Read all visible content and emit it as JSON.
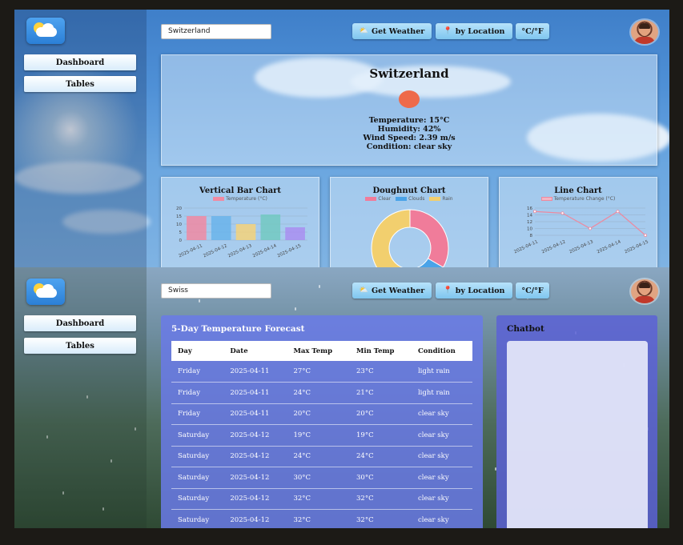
{
  "top": {
    "sidebar": {
      "items": [
        {
          "label": "Dashboard"
        },
        {
          "label": "Tables"
        }
      ]
    },
    "search": {
      "value": "Switzerland"
    },
    "toolbar": {
      "get_weather": "Get Weather",
      "by_location": "by Location",
      "unit_toggle": "°C/°F"
    },
    "current": {
      "city": "Switzerland",
      "temperature": "Temperature: 15°C",
      "humidity": "Humidity: 42%",
      "wind": "Wind Speed: 2.39 m/s",
      "condition": "Condition: clear sky"
    },
    "charts": {
      "bar_title": "Vertical Bar Chart",
      "doughnut_title": "Doughnut Chart",
      "line_title": "Line Chart"
    }
  },
  "bottom": {
    "sidebar": {
      "items": [
        {
          "label": "Dashboard"
        },
        {
          "label": "Tables"
        }
      ]
    },
    "search": {
      "value": "Swiss"
    },
    "toolbar": {
      "get_weather": "Get Weather",
      "by_location": "by Location",
      "unit_toggle": "°C/°F"
    },
    "forecast": {
      "title": "5-Day Temperature Forecast",
      "columns": [
        "Day",
        "Date",
        "Max Temp",
        "Min Temp",
        "Condition"
      ],
      "rows": [
        [
          "Friday",
          "2025-04-11",
          "27°C",
          "23°C",
          "light rain"
        ],
        [
          "Friday",
          "2025-04-11",
          "24°C",
          "21°C",
          "light rain"
        ],
        [
          "Friday",
          "2025-04-11",
          "20°C",
          "20°C",
          "clear sky"
        ],
        [
          "Saturday",
          "2025-04-12",
          "19°C",
          "19°C",
          "clear sky"
        ],
        [
          "Saturday",
          "2025-04-12",
          "24°C",
          "24°C",
          "clear sky"
        ],
        [
          "Saturday",
          "2025-04-12",
          "30°C",
          "30°C",
          "clear sky"
        ],
        [
          "Saturday",
          "2025-04-12",
          "32°C",
          "32°C",
          "clear sky"
        ],
        [
          "Saturday",
          "2025-04-12",
          "32°C",
          "32°C",
          "clear sky"
        ]
      ]
    },
    "chatbot": {
      "title": "Chatbot"
    }
  },
  "chart_data": [
    {
      "type": "bar",
      "title": "Vertical Bar Chart",
      "categories": [
        "2025-04-11",
        "2025-04-12",
        "2025-04-13",
        "2025-04-14",
        "2025-04-15"
      ],
      "series": [
        {
          "name": "Temperature (°C)",
          "values": [
            15,
            15,
            10,
            16,
            8
          ]
        }
      ],
      "colors": [
        "#f08aa2",
        "#6ab4ea",
        "#f5d27a",
        "#72c9c1",
        "#a98ef0"
      ],
      "ylim": [
        0,
        20
      ],
      "yticks": [
        0,
        5,
        10,
        15,
        20
      ],
      "legend": "top"
    },
    {
      "type": "pie",
      "title": "Doughnut Chart",
      "labels": [
        "Clear",
        "Clouds",
        "Rain"
      ],
      "values": [
        2,
        1,
        3
      ],
      "colors": [
        "#f07c9a",
        "#4aa3e8",
        "#f2cf6e"
      ],
      "legend": "top"
    },
    {
      "type": "line",
      "title": "Line Chart",
      "x": [
        "2025-04-11",
        "2025-04-12",
        "2025-04-13",
        "2025-04-14",
        "2025-04-15"
      ],
      "series": [
        {
          "name": "Temperature Change (°C)",
          "values": [
            15,
            14.5,
            10,
            15,
            8
          ]
        }
      ],
      "color": "#ec8aa0",
      "ylim": [
        8,
        16
      ],
      "yticks": [
        8,
        10,
        12,
        14,
        16
      ],
      "legend": "top"
    }
  ]
}
